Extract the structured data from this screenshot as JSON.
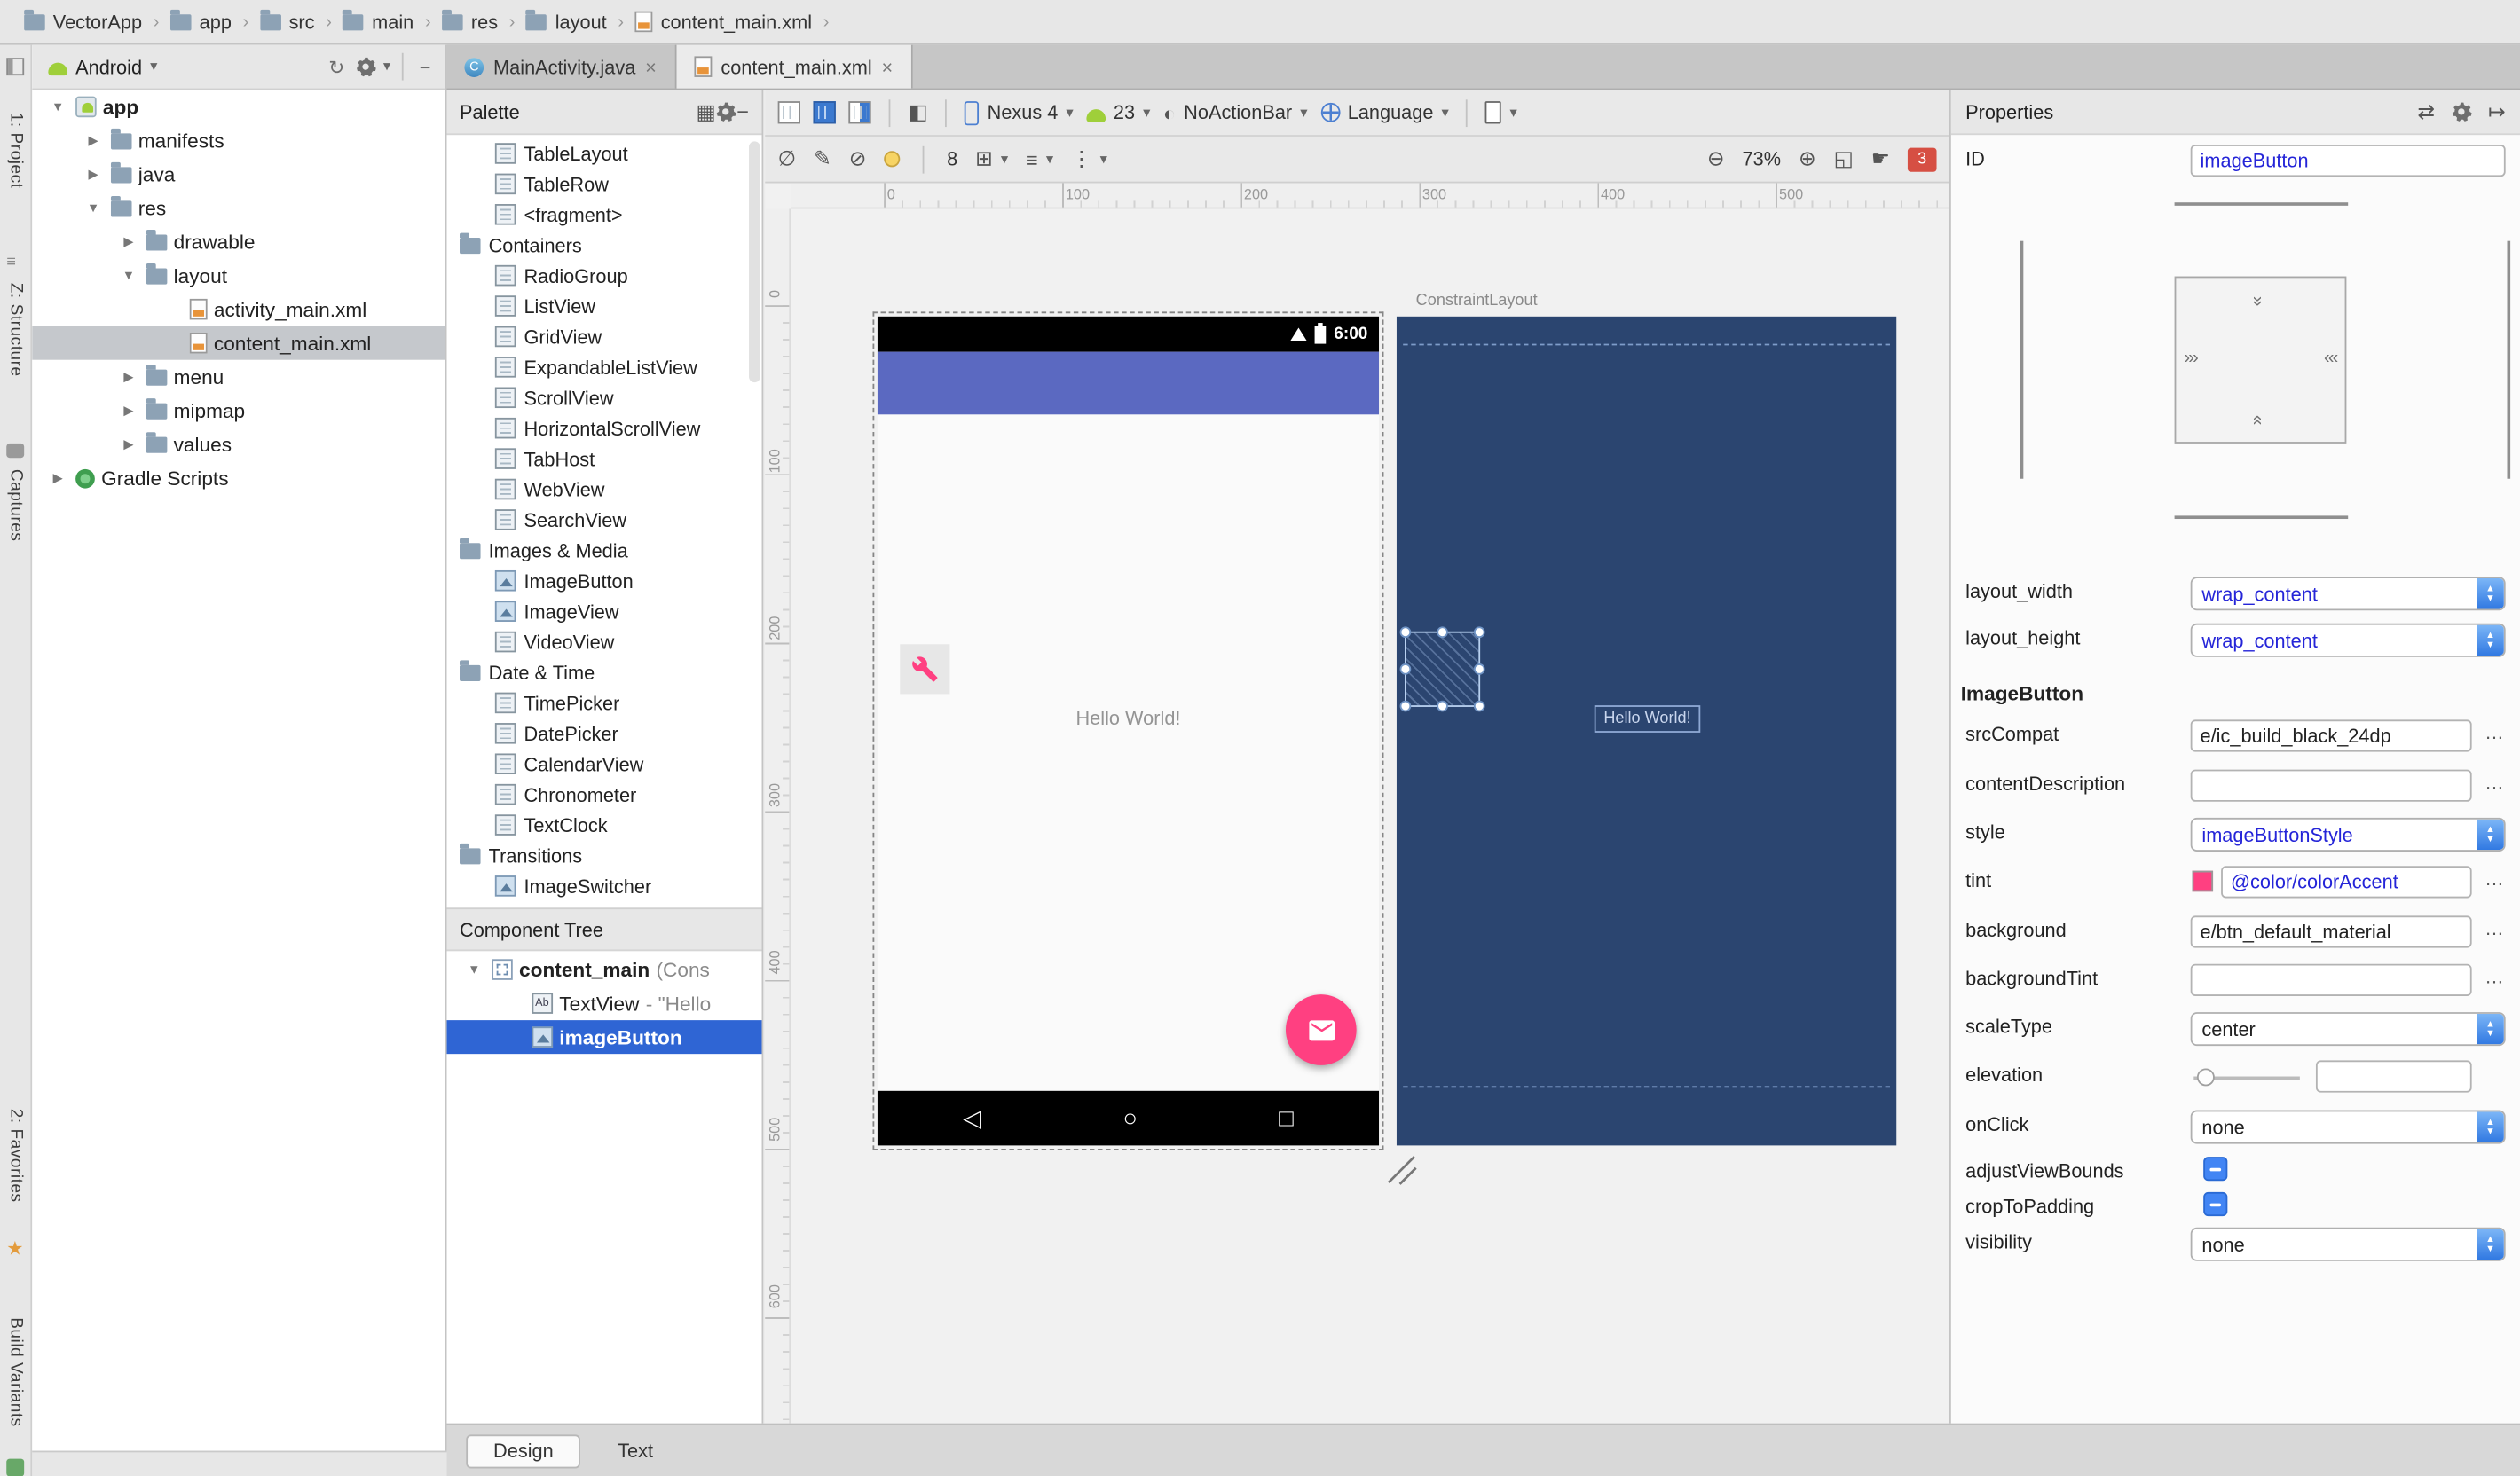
{
  "colors": {
    "accent": "#ff4081",
    "appbar": "#5b69c1",
    "blueprint_bg": "#2b4570",
    "selection_blue": "#2f65d4",
    "value_blue": "#2525d8"
  },
  "icons": {
    "expander_open": "▼",
    "expander_closed": "▶",
    "breadcrumb_chevron": "›",
    "close": "×",
    "caret": "▾",
    "sync": "↻",
    "minimize": "−",
    "grid": "▦",
    "eye_off": "∅",
    "pencil": "✎",
    "clear_constraints": "⊘",
    "half_circle": "◐",
    "snap_grid": "⊞",
    "align": "≡",
    "distribute": "⋮",
    "zoom_out": "⊖",
    "zoom_in": "⊕",
    "zoom_fit": "◱",
    "pan_hand": "☛",
    "swap": "⇄",
    "jump": "↦",
    "nav_back": "◁",
    "nav_home": "○",
    "nav_recents": "□",
    "more": "…",
    "wrap_left": "›››",
    "wrap_right": "‹‹‹",
    "wrap_top": "››",
    "wrap_bottom": "‹‹",
    "paint": "◧"
  },
  "breadcrumb": [
    "VectorApp",
    "app",
    "src",
    "main",
    "res",
    "layout",
    "content_main.xml"
  ],
  "left_strip": {
    "top": [
      "1: Project",
      "Z: Structure",
      "Captures"
    ],
    "bottom": [
      "2: Favorites",
      "Build Variants"
    ]
  },
  "project": {
    "view": "Android",
    "tree": [
      {
        "label": "app"
      },
      {
        "label": "manifests"
      },
      {
        "label": "java"
      },
      {
        "label": "res"
      },
      {
        "label": "drawable"
      },
      {
        "label": "layout"
      },
      {
        "label": "activity_main.xml"
      },
      {
        "label": "content_main.xml"
      },
      {
        "label": "menu"
      },
      {
        "label": "mipmap"
      },
      {
        "label": "values"
      },
      {
        "label": "Gradle Scripts"
      }
    ]
  },
  "editor_tabs": [
    {
      "label": "MainActivity.java"
    },
    {
      "label": "content_main.xml"
    }
  ],
  "palette": {
    "title": "Palette",
    "items": [
      {
        "t": "item",
        "label": "TableLayout"
      },
      {
        "t": "item",
        "label": "TableRow"
      },
      {
        "t": "item",
        "label": "<fragment>"
      },
      {
        "t": "header",
        "label": "Containers"
      },
      {
        "t": "item",
        "label": "RadioGroup"
      },
      {
        "t": "item",
        "label": "ListView"
      },
      {
        "t": "item",
        "label": "GridView"
      },
      {
        "t": "item",
        "label": "ExpandableListView"
      },
      {
        "t": "item",
        "label": "ScrollView"
      },
      {
        "t": "item",
        "label": "HorizontalScrollView"
      },
      {
        "t": "item",
        "label": "TabHost"
      },
      {
        "t": "item",
        "label": "WebView"
      },
      {
        "t": "item",
        "label": "SearchView"
      },
      {
        "t": "header",
        "label": "Images & Media"
      },
      {
        "t": "item",
        "label": "ImageButton"
      },
      {
        "t": "item",
        "label": "ImageView"
      },
      {
        "t": "item",
        "label": "VideoView"
      },
      {
        "t": "header",
        "label": "Date & Time"
      },
      {
        "t": "item",
        "label": "TimePicker"
      },
      {
        "t": "item",
        "label": "DatePicker"
      },
      {
        "t": "item",
        "label": "CalendarView"
      },
      {
        "t": "item",
        "label": "Chronometer"
      },
      {
        "t": "item",
        "label": "TextClock"
      },
      {
        "t": "header",
        "label": "Transitions"
      },
      {
        "t": "item",
        "label": "ImageSwitcher"
      }
    ]
  },
  "component_tree": {
    "title": "Component Tree",
    "rows": [
      {
        "label": "content_main",
        "suffix": " (Cons"
      },
      {
        "label": "TextView",
        "suffix": " - \"Hello"
      },
      {
        "label": "imageButton",
        "suffix": ""
      }
    ]
  },
  "design_toolbar": {
    "device": "Nexus 4",
    "api_level": "23",
    "theme": "NoActionBar",
    "language": "Language",
    "margin": "8",
    "zoom": "73%",
    "errors": "3"
  },
  "canvas": {
    "h_ruler": [
      "0",
      "100",
      "200",
      "300",
      "400",
      "500"
    ],
    "v_ruler": [
      "0",
      "100",
      "200",
      "300",
      "400",
      "500",
      "600"
    ],
    "design": {
      "time": "6:00",
      "hello": "Hello World!"
    },
    "blueprint": {
      "label": "ConstraintLayout",
      "hello": "Hello World!"
    }
  },
  "properties": {
    "title": "Properties",
    "id": {
      "label": "ID",
      "value": "imageButton"
    },
    "layout_width": {
      "label": "layout_width",
      "value": "wrap_content"
    },
    "layout_height": {
      "label": "layout_height",
      "value": "wrap_content"
    },
    "section": "ImageButton",
    "srcCompat": {
      "label": "srcCompat",
      "value": "e/ic_build_black_24dp"
    },
    "contentDescription": {
      "label": "contentDescription",
      "value": ""
    },
    "style": {
      "label": "style",
      "value": "imageButtonStyle"
    },
    "tint": {
      "label": "tint",
      "value": "@color/colorAccent",
      "swatch": "#ff4081"
    },
    "background": {
      "label": "background",
      "value": "e/btn_default_material"
    },
    "backgroundTint": {
      "label": "backgroundTint",
      "value": ""
    },
    "scaleType": {
      "label": "scaleType",
      "value": "center"
    },
    "elevation": {
      "label": "elevation",
      "value": ""
    },
    "onClick": {
      "label": "onClick",
      "value": "none"
    },
    "adjustViewBounds": {
      "label": "adjustViewBounds"
    },
    "cropToPadding": {
      "label": "cropToPadding"
    },
    "visibility": {
      "label": "visibility",
      "value": "none"
    }
  },
  "bottom_bar": {
    "tabs": [
      {
        "label": "Design"
      },
      {
        "label": "Text"
      }
    ]
  }
}
